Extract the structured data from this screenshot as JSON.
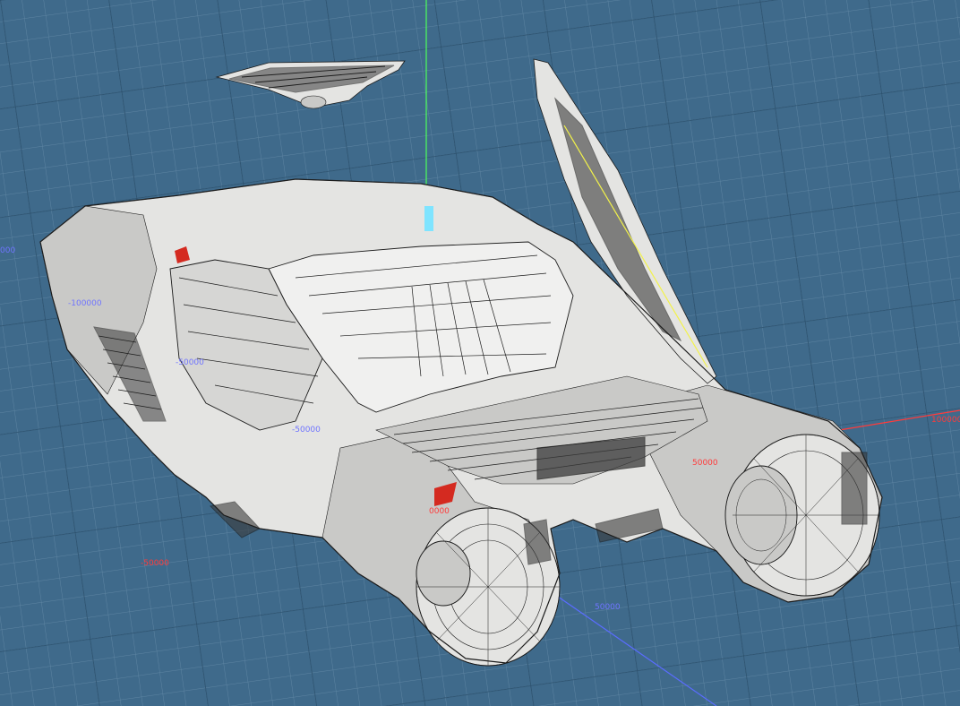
{
  "viewport": {
    "background_color": "#3f6a8b",
    "grid_minor_color": "#5d84a2",
    "grid_major_color": "#2a4f6c"
  },
  "axes": {
    "y_axis_color": "#4dff5a",
    "x_axis_color": "#ff3b3b",
    "z_axis_color": "#5a6cff"
  },
  "axis_labels": [
    {
      "text": "000",
      "color": "#6f74ff"
    },
    {
      "text": "-100000",
      "color": "#6f74ff"
    },
    {
      "text": "-50000",
      "color": "#6f74ff"
    },
    {
      "text": "-50000",
      "color": "#6f74ff"
    },
    {
      "text": "0000",
      "color": "#ff3a3a"
    },
    {
      "text": "50000",
      "color": "#ff3a3a"
    },
    {
      "text": "100000",
      "color": "#ff3a3a"
    },
    {
      "text": "-50000",
      "color": "#ff3a3a"
    },
    {
      "text": "50000",
      "color": "#6f74ff"
    }
  ],
  "model": {
    "body_color": "#e4e4e2",
    "body_shade_color": "#c9c9c7",
    "dark_color": "#3b3b3b",
    "wire_color": "#1c1c1c",
    "accent_color": "#d42a20",
    "selection_color": "#f2f24a",
    "highlight_color": "#7fe4ff"
  }
}
